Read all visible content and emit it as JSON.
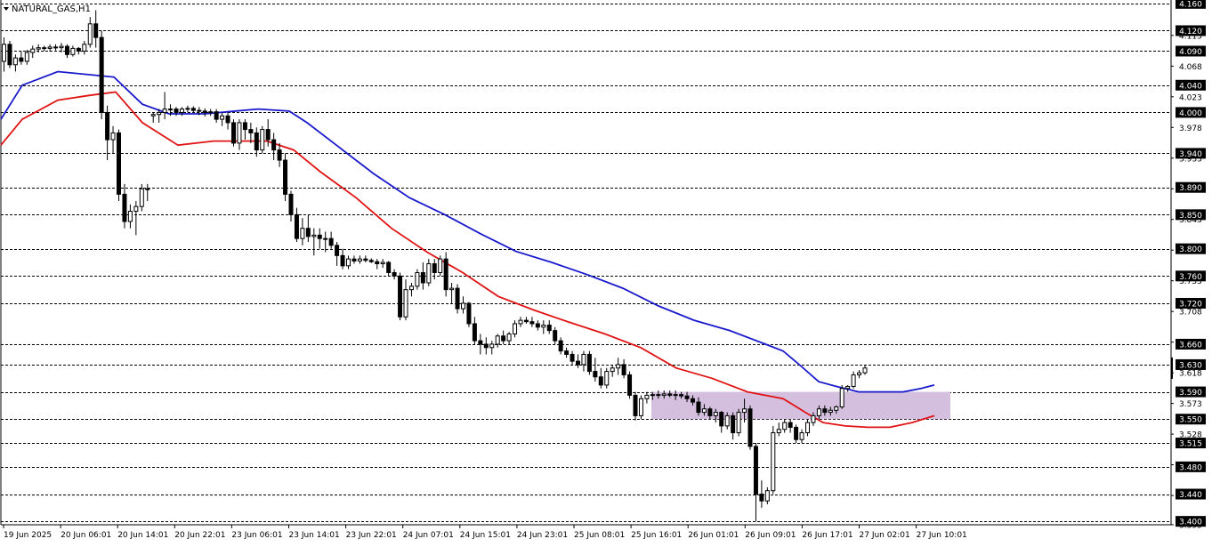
{
  "chart_data": {
    "type": "candlestick",
    "title": "NATURAL_GAS,H1",
    "ylim": [
      3.395,
      4.165
    ],
    "y_ticks": [
      4.113,
      4.068,
      4.023,
      3.978,
      3.933,
      3.888,
      3.843,
      3.798,
      3.753,
      3.708,
      3.663,
      3.618,
      3.573,
      3.528,
      3.483,
      3.438,
      3.395
    ],
    "levels": [
      4.16,
      4.12,
      4.09,
      4.04,
      4.0,
      3.94,
      3.89,
      3.85,
      3.8,
      3.76,
      3.72,
      3.66,
      3.63,
      3.59,
      3.55,
      3.515,
      3.48,
      3.44,
      3.4
    ],
    "level_labels": [
      "4.160",
      "4.120",
      "4.090",
      "4.040",
      "4.000",
      "3.940",
      "3.890",
      "3.850",
      "3.800",
      "3.760",
      "3.720",
      "3.660",
      "3.630",
      "3.590",
      "3.550",
      "3.515",
      "3.480",
      "3.440",
      "3.400"
    ],
    "x_labels": [
      "19 Jun 2025",
      "20 Jun 06:01",
      "20 Jun 14:01",
      "20 Jun 22:01",
      "23 Jun 06:01",
      "23 Jun 14:01",
      "23 Jun 22:01",
      "24 Jun 07:01",
      "24 Jun 15:01",
      "24 Jun 23:01",
      "25 Jun 08:01",
      "25 Jun 16:01",
      "26 Jun 01:01",
      "26 Jun 09:01",
      "26 Jun 17:01",
      "27 Jun 02:01",
      "27 Jun 10:01"
    ],
    "current_price": 3.63,
    "zone": {
      "low": 3.55,
      "high": 3.59,
      "color": "#d4bfdf"
    },
    "ohlc": [
      [
        4.075,
        4.11,
        4.06,
        4.1
      ],
      [
        4.1,
        4.105,
        4.065,
        4.07
      ],
      [
        4.07,
        4.085,
        4.06,
        4.08
      ],
      [
        4.08,
        4.09,
        4.07,
        4.075
      ],
      [
        4.075,
        4.092,
        4.07,
        4.088
      ],
      [
        4.088,
        4.098,
        4.08,
        4.093
      ],
      [
        4.093,
        4.1,
        4.088,
        4.095
      ],
      [
        4.095,
        4.098,
        4.09,
        4.094
      ],
      [
        4.094,
        4.1,
        4.089,
        4.096
      ],
      [
        4.096,
        4.1,
        4.091,
        4.095
      ],
      [
        4.095,
        4.102,
        4.088,
        4.097
      ],
      [
        4.097,
        4.1,
        4.08,
        4.085
      ],
      [
        4.085,
        4.098,
        4.082,
        4.094
      ],
      [
        4.094,
        4.096,
        4.085,
        4.09
      ],
      [
        4.09,
        4.105,
        4.085,
        4.1
      ],
      [
        4.1,
        4.14,
        4.095,
        4.13
      ],
      [
        4.13,
        4.15,
        4.095,
        4.11
      ],
      [
        4.11,
        4.12,
        3.99,
        4.0
      ],
      [
        4.0,
        4.01,
        3.93,
        3.96
      ],
      [
        3.96,
        3.98,
        3.94,
        3.97
      ],
      [
        3.97,
        3.975,
        3.87,
        3.88
      ],
      [
        3.88,
        3.895,
        3.83,
        3.84
      ],
      [
        3.84,
        3.865,
        3.83,
        3.855
      ],
      [
        3.855,
        3.87,
        3.82,
        3.862
      ],
      [
        3.862,
        3.895,
        3.855,
        3.888
      ],
      [
        3.888,
        3.895,
        3.87,
        3.888
      ],
      [
        3.995,
        4.0,
        3.985,
        3.997
      ],
      [
        3.997,
        4.005,
        3.985,
        4.0
      ],
      [
        4.0,
        4.03,
        3.99,
        4.005
      ],
      [
        4.005,
        4.012,
        3.995,
        4.005
      ],
      [
        4.005,
        4.008,
        3.995,
        4.0
      ],
      [
        4.0,
        4.008,
        3.995,
        4.005
      ],
      [
        4.005,
        4.01,
        4.0,
        4.006
      ],
      [
        4.006,
        4.009,
        4.0,
        4.003
      ],
      [
        4.003,
        4.008,
        3.996,
        4.002
      ],
      [
        4.002,
        4.006,
        3.994,
        4.0
      ],
      [
        4.0,
        4.005,
        3.995,
        4.001
      ],
      [
        4.001,
        4.005,
        3.985,
        3.99
      ],
      [
        3.99,
        4.0,
        3.98,
        3.995
      ],
      [
        3.995,
        4.0,
        3.975,
        3.985
      ],
      [
        3.985,
        3.99,
        3.95,
        3.955
      ],
      [
        3.955,
        3.99,
        3.945,
        3.985
      ],
      [
        3.985,
        3.99,
        3.96,
        3.975
      ],
      [
        3.975,
        3.985,
        3.955,
        3.97
      ],
      [
        3.97,
        3.978,
        3.935,
        3.945
      ],
      [
        3.945,
        3.98,
        3.94,
        3.975
      ],
      [
        3.975,
        3.99,
        3.95,
        3.96
      ],
      [
        3.96,
        3.97,
        3.93,
        3.945
      ],
      [
        3.945,
        3.955,
        3.92,
        3.93
      ],
      [
        3.93,
        3.94,
        3.87,
        3.88
      ],
      [
        3.88,
        3.885,
        3.84,
        3.85
      ],
      [
        3.85,
        3.86,
        3.81,
        3.815
      ],
      [
        3.815,
        3.845,
        3.805,
        3.83
      ],
      [
        3.83,
        3.85,
        3.81,
        3.818
      ],
      [
        3.818,
        3.83,
        3.79,
        3.82
      ],
      [
        3.82,
        3.83,
        3.8,
        3.815
      ],
      [
        3.815,
        3.825,
        3.795,
        3.815
      ],
      [
        3.815,
        3.825,
        3.8,
        3.805
      ],
      [
        3.805,
        3.81,
        3.775,
        3.79
      ],
      [
        3.79,
        3.8,
        3.77,
        3.775
      ],
      [
        3.775,
        3.79,
        3.77,
        3.785
      ],
      [
        3.785,
        3.79,
        3.778,
        3.782
      ],
      [
        3.782,
        3.79,
        3.778,
        3.785
      ],
      [
        3.785,
        3.79,
        3.78,
        3.783
      ],
      [
        3.783,
        3.786,
        3.779,
        3.781
      ],
      [
        3.781,
        3.785,
        3.77,
        3.778
      ],
      [
        3.778,
        3.785,
        3.772,
        3.78
      ],
      [
        3.78,
        3.782,
        3.76,
        3.765
      ],
      [
        3.765,
        3.77,
        3.755,
        3.76
      ],
      [
        3.76,
        3.765,
        3.695,
        3.7
      ],
      [
        3.7,
        3.755,
        3.695,
        3.74
      ],
      [
        3.74,
        3.75,
        3.73,
        3.745
      ],
      [
        3.745,
        3.77,
        3.74,
        3.765
      ],
      [
        3.765,
        3.78,
        3.74,
        3.75
      ],
      [
        3.75,
        3.785,
        3.745,
        3.778
      ],
      [
        3.778,
        3.785,
        3.755,
        3.765
      ],
      [
        3.765,
        3.79,
        3.76,
        3.785
      ],
      [
        3.785,
        3.795,
        3.73,
        3.74
      ],
      [
        3.74,
        3.75,
        3.72,
        3.742
      ],
      [
        3.742,
        3.748,
        3.705,
        3.712
      ],
      [
        3.712,
        3.73,
        3.705,
        3.72
      ],
      [
        3.72,
        3.722,
        3.685,
        3.69
      ],
      [
        3.69,
        3.7,
        3.66,
        3.665
      ],
      [
        3.665,
        3.675,
        3.645,
        3.66
      ],
      [
        3.66,
        3.67,
        3.645,
        3.655
      ],
      [
        3.655,
        3.665,
        3.645,
        3.66
      ],
      [
        3.66,
        3.675,
        3.655,
        3.672
      ],
      [
        3.672,
        3.68,
        3.66,
        3.665
      ],
      [
        3.665,
        3.678,
        3.66,
        3.675
      ],
      [
        3.675,
        3.695,
        3.67,
        3.69
      ],
      [
        3.69,
        3.7,
        3.685,
        3.695
      ],
      [
        3.695,
        3.7,
        3.69,
        3.693
      ],
      [
        3.693,
        3.7,
        3.685,
        3.69
      ],
      [
        3.69,
        3.695,
        3.68,
        3.685
      ],
      [
        3.685,
        3.695,
        3.675,
        3.688
      ],
      [
        3.688,
        3.695,
        3.675,
        3.68
      ],
      [
        3.68,
        3.685,
        3.66,
        3.665
      ],
      [
        3.665,
        3.67,
        3.645,
        3.65
      ],
      [
        3.65,
        3.655,
        3.64,
        3.645
      ],
      [
        3.645,
        3.65,
        3.63,
        3.635
      ],
      [
        3.635,
        3.645,
        3.625,
        3.63
      ],
      [
        3.63,
        3.65,
        3.62,
        3.645
      ],
      [
        3.645,
        3.65,
        3.615,
        3.62
      ],
      [
        3.62,
        3.64,
        3.605,
        3.612
      ],
      [
        3.612,
        3.625,
        3.595,
        3.6
      ],
      [
        3.6,
        3.625,
        3.595,
        3.62
      ],
      [
        3.62,
        3.63,
        3.612,
        3.625
      ],
      [
        3.625,
        3.64,
        3.615,
        3.63
      ],
      [
        3.63,
        3.638,
        3.61,
        3.615
      ],
      [
        3.615,
        3.62,
        3.58,
        3.585
      ],
      [
        3.585,
        3.59,
        3.548,
        3.555
      ],
      [
        3.555,
        3.585,
        3.55,
        3.58
      ],
      [
        3.58,
        3.59,
        3.573,
        3.585
      ],
      [
        3.585,
        3.59,
        3.578,
        3.586
      ],
      [
        3.586,
        3.592,
        3.58,
        3.585
      ],
      [
        3.585,
        3.592,
        3.58,
        3.587
      ],
      [
        3.587,
        3.592,
        3.582,
        3.585
      ],
      [
        3.585,
        3.592,
        3.578,
        3.586
      ],
      [
        3.586,
        3.59,
        3.58,
        3.584
      ],
      [
        3.584,
        3.59,
        3.575,
        3.58
      ],
      [
        3.58,
        3.585,
        3.57,
        3.575
      ],
      [
        3.575,
        3.582,
        3.555,
        3.56
      ],
      [
        3.56,
        3.572,
        3.555,
        3.565
      ],
      [
        3.565,
        3.568,
        3.55,
        3.555
      ],
      [
        3.555,
        3.565,
        3.545,
        3.56
      ],
      [
        3.56,
        3.562,
        3.53,
        3.54
      ],
      [
        3.54,
        3.56,
        3.535,
        3.555
      ],
      [
        3.555,
        3.56,
        3.52,
        3.53
      ],
      [
        3.53,
        3.565,
        3.525,
        3.56
      ],
      [
        3.56,
        3.58,
        3.545,
        3.565
      ],
      [
        3.565,
        3.57,
        3.505,
        3.51
      ],
      [
        3.51,
        3.515,
        3.4,
        3.44
      ],
      [
        3.44,
        3.46,
        3.42,
        3.43
      ],
      [
        3.43,
        3.45,
        3.425,
        3.445
      ],
      [
        3.445,
        3.54,
        3.44,
        3.53
      ],
      [
        3.53,
        3.545,
        3.525,
        3.535
      ],
      [
        3.535,
        3.55,
        3.53,
        3.545
      ],
      [
        3.545,
        3.55,
        3.53,
        3.538
      ],
      [
        3.538,
        3.542,
        3.515,
        3.52
      ],
      [
        3.52,
        3.535,
        3.515,
        3.53
      ],
      [
        3.53,
        3.55,
        3.525,
        3.545
      ],
      [
        3.545,
        3.56,
        3.54,
        3.555
      ],
      [
        3.555,
        3.57,
        3.55,
        3.565
      ],
      [
        3.565,
        3.57,
        3.555,
        3.56
      ],
      [
        3.56,
        3.568,
        3.555,
        3.563
      ],
      [
        3.563,
        3.57,
        3.558,
        3.568
      ],
      [
        3.568,
        3.6,
        3.565,
        3.595
      ],
      [
        3.595,
        3.6,
        3.59,
        3.598
      ],
      [
        3.598,
        3.62,
        3.595,
        3.615
      ],
      [
        3.615,
        3.622,
        3.61,
        3.618
      ],
      [
        3.618,
        3.63,
        3.615,
        3.625
      ]
    ],
    "blue_ma": [
      [
        1,
        3.99
      ],
      [
        25,
        4.04
      ],
      [
        65,
        4.06
      ],
      [
        128,
        4.052
      ],
      [
        160,
        4.012
      ],
      [
        190,
        3.998
      ],
      [
        230,
        3.998
      ],
      [
        290,
        4.005
      ],
      [
        325,
        4.002
      ],
      [
        345,
        3.985
      ],
      [
        380,
        3.95
      ],
      [
        420,
        3.91
      ],
      [
        460,
        3.875
      ],
      [
        500,
        3.85
      ],
      [
        540,
        3.822
      ],
      [
        580,
        3.796
      ],
      [
        620,
        3.78
      ],
      [
        660,
        3.762
      ],
      [
        700,
        3.742
      ],
      [
        740,
        3.716
      ],
      [
        780,
        3.695
      ],
      [
        820,
        3.68
      ],
      [
        860,
        3.66
      ],
      [
        880,
        3.65
      ],
      [
        900,
        3.628
      ],
      [
        920,
        3.605
      ],
      [
        940,
        3.598
      ],
      [
        965,
        3.59
      ],
      [
        990,
        3.59
      ],
      [
        1015,
        3.59
      ],
      [
        1035,
        3.595
      ],
      [
        1050,
        3.6
      ]
    ],
    "red_ma": [
      [
        1,
        3.952
      ],
      [
        25,
        3.99
      ],
      [
        65,
        4.018
      ],
      [
        100,
        4.025
      ],
      [
        130,
        4.03
      ],
      [
        160,
        3.985
      ],
      [
        200,
        3.952
      ],
      [
        240,
        3.958
      ],
      [
        300,
        3.958
      ],
      [
        330,
        3.945
      ],
      [
        360,
        3.913
      ],
      [
        400,
        3.875
      ],
      [
        440,
        3.83
      ],
      [
        480,
        3.795
      ],
      [
        520,
        3.765
      ],
      [
        560,
        3.73
      ],
      [
        600,
        3.71
      ],
      [
        640,
        3.692
      ],
      [
        680,
        3.675
      ],
      [
        720,
        3.655
      ],
      [
        760,
        3.625
      ],
      [
        800,
        3.61
      ],
      [
        840,
        3.59
      ],
      [
        880,
        3.58
      ],
      [
        905,
        3.56
      ],
      [
        925,
        3.545
      ],
      [
        950,
        3.54
      ],
      [
        975,
        3.538
      ],
      [
        1000,
        3.538
      ],
      [
        1025,
        3.545
      ],
      [
        1050,
        3.555
      ]
    ]
  }
}
